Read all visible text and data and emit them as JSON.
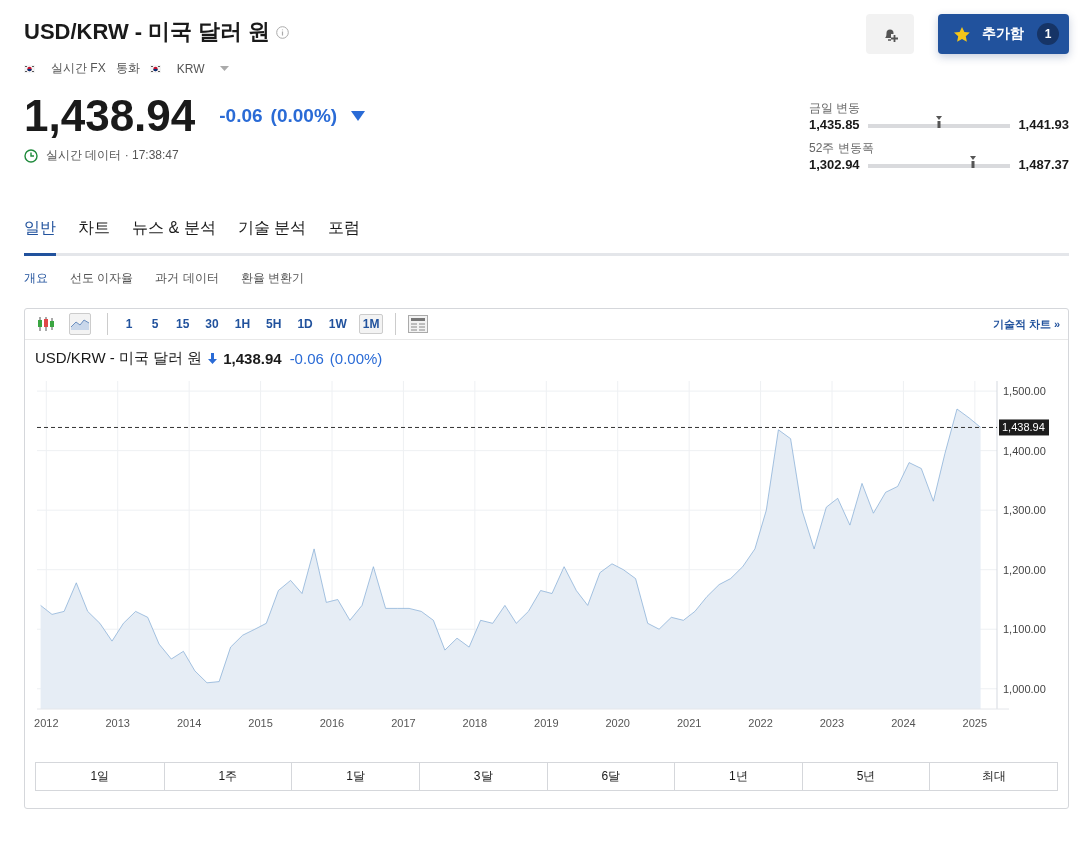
{
  "header": {
    "title": "USD/KRW - 미국 달러 원",
    "watchlist_button": {
      "label": "추가함",
      "count": "1"
    }
  },
  "tags": [
    {
      "label": "실시간 FX",
      "kind": "flag"
    },
    {
      "label": "통화",
      "kind": "plain"
    },
    {
      "label": "KRW",
      "kind": "flag-menu"
    }
  ],
  "quote": {
    "price": "1,438.94",
    "change": "-0.06",
    "change_pct": "(0.00%)",
    "status": "실시간 데이터 · 17:38:47"
  },
  "ranges": [
    {
      "label": "금일 변동",
      "low": "1,435.85",
      "high": "1,441.93",
      "level": 0.5
    },
    {
      "label": "52주 변동폭",
      "low": "1,302.94",
      "high": "1,487.37",
      "level": 0.74
    }
  ],
  "tabs": [
    {
      "label": "일반",
      "selected": true
    },
    {
      "label": "차트",
      "selected": false
    },
    {
      "label": "뉴스 & 분석",
      "selected": false
    },
    {
      "label": "기술 분석",
      "selected": false
    },
    {
      "label": "포럼",
      "selected": false
    }
  ],
  "subtabs": [
    {
      "label": "개요",
      "selected": true
    },
    {
      "label": "선도 이자율",
      "selected": false
    },
    {
      "label": "과거 데이터",
      "selected": false
    },
    {
      "label": "환율 변환기",
      "selected": false
    }
  ],
  "chart_panel": {
    "chart_types": [
      {
        "kind": "candles",
        "selected": false
      },
      {
        "kind": "area",
        "selected": true
      }
    ],
    "intervals": [
      {
        "label": "1",
        "selected": false
      },
      {
        "label": "5",
        "selected": false
      },
      {
        "label": "15",
        "selected": false
      },
      {
        "label": "30",
        "selected": false
      },
      {
        "label": "1H",
        "selected": false
      },
      {
        "label": "5H",
        "selected": false
      },
      {
        "label": "1D",
        "selected": false
      },
      {
        "label": "1W",
        "selected": false
      },
      {
        "label": "1M",
        "selected": true
      }
    ],
    "link": "기술적 차트 »",
    "title": "USD/KRW - 미국 달러 원",
    "price": "1,438.94",
    "change": "-0.06",
    "change_pct": "(0.00%)",
    "chart_data": {
      "type": "area",
      "grid": true,
      "xlim": [
        2011.87,
        2025.31
      ],
      "ylim": [
        966,
        1517
      ],
      "xticks": [
        2012,
        2013,
        2014,
        2015,
        2016,
        2017,
        2018,
        2019,
        2020,
        2021,
        2022,
        2023,
        2024,
        2025
      ],
      "yticks": [
        {
          "value": 1000,
          "label": "1,000.00"
        },
        {
          "value": 1100,
          "label": "1,100.00"
        },
        {
          "value": 1200,
          "label": "1,200.00"
        },
        {
          "value": 1300,
          "label": "1,300.00"
        },
        {
          "value": 1400,
          "label": "1,400.00"
        },
        {
          "value": 1500,
          "label": "1,500.00"
        }
      ],
      "x": [
        2011.92,
        2012.08,
        2012.25,
        2012.42,
        2012.58,
        2012.75,
        2012.92,
        2013.08,
        2013.25,
        2013.42,
        2013.58,
        2013.75,
        2013.92,
        2014.08,
        2014.25,
        2014.42,
        2014.58,
        2014.75,
        2014.92,
        2015.08,
        2015.25,
        2015.42,
        2015.58,
        2015.75,
        2015.92,
        2016.08,
        2016.25,
        2016.42,
        2016.58,
        2016.75,
        2016.92,
        2017.08,
        2017.25,
        2017.42,
        2017.58,
        2017.75,
        2017.92,
        2018.08,
        2018.25,
        2018.42,
        2018.58,
        2018.75,
        2018.92,
        2019.08,
        2019.25,
        2019.42,
        2019.58,
        2019.75,
        2019.92,
        2020.08,
        2020.25,
        2020.42,
        2020.58,
        2020.75,
        2020.92,
        2021.08,
        2021.25,
        2021.42,
        2021.58,
        2021.75,
        2021.92,
        2022.08,
        2022.25,
        2022.42,
        2022.58,
        2022.75,
        2022.92,
        2023.08,
        2023.25,
        2023.42,
        2023.58,
        2023.75,
        2023.92,
        2024.08,
        2024.25,
        2024.42,
        2024.58,
        2024.75,
        2024.92,
        2025.08
      ],
      "series": [
        {
          "color": "#7fa9d4",
          "values": [
            1140,
            1125,
            1130,
            1178,
            1130,
            1110,
            1080,
            1110,
            1130,
            1120,
            1075,
            1050,
            1063,
            1030,
            1010,
            1012,
            1070,
            1090,
            1100,
            1110,
            1165,
            1182,
            1160,
            1235,
            1145,
            1150,
            1115,
            1140,
            1205,
            1135,
            1135,
            1135,
            1130,
            1115,
            1065,
            1085,
            1070,
            1115,
            1110,
            1140,
            1110,
            1130,
            1165,
            1160,
            1205,
            1165,
            1140,
            1195,
            1210,
            1200,
            1185,
            1110,
            1100,
            1120,
            1115,
            1130,
            1155,
            1175,
            1185,
            1205,
            1235,
            1300,
            1435,
            1420,
            1300,
            1235,
            1305,
            1320,
            1275,
            1345,
            1295,
            1330,
            1340,
            1380,
            1370,
            1315,
            1395,
            1470,
            1455,
            1439
          ]
        }
      ],
      "ref_lines": [
        {
          "axis": "y",
          "value": 1438.94,
          "label": "1,438.94"
        }
      ]
    },
    "periods": [
      "1일",
      "1주",
      "1달",
      "3달",
      "6달",
      "1년",
      "5년",
      "최대"
    ]
  }
}
